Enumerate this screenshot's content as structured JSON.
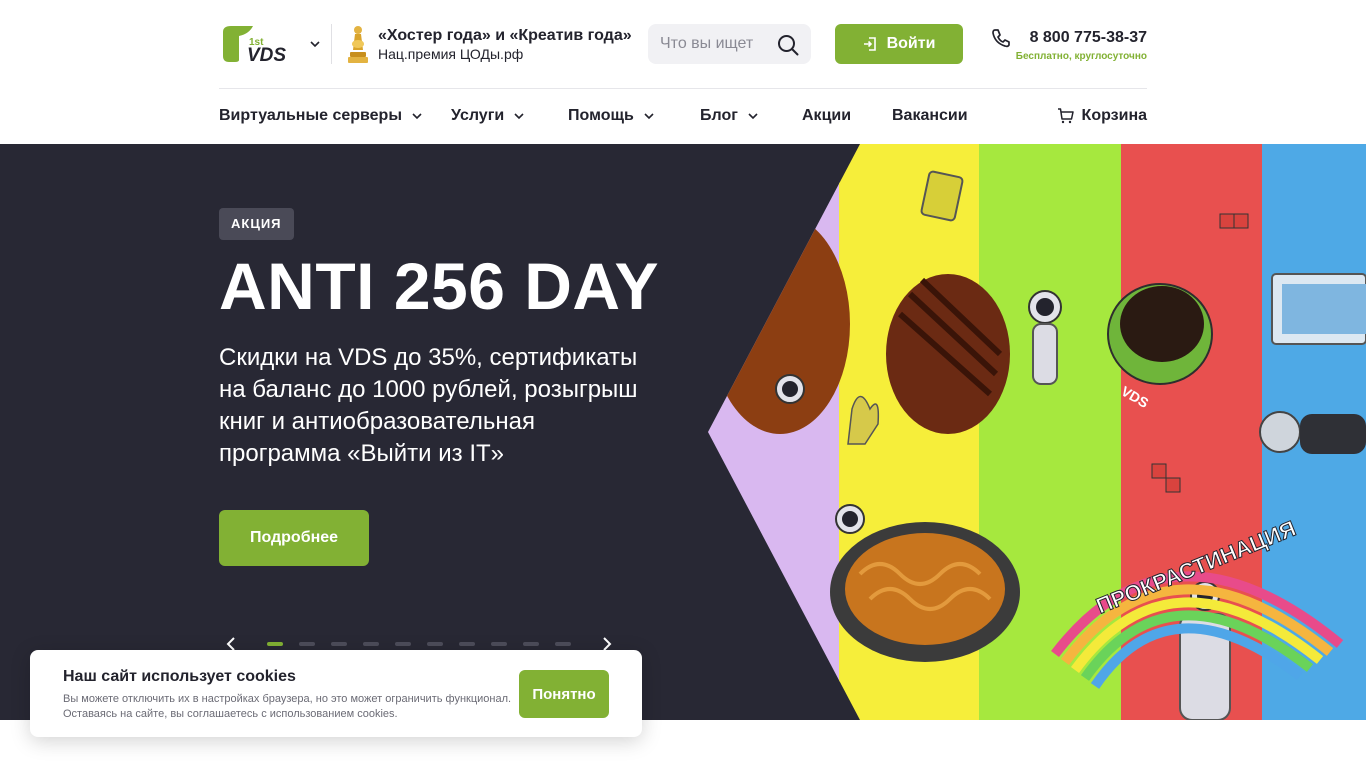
{
  "brand": {
    "logo_text": "VDS",
    "logo_sup": "1st",
    "accent": "#82b134",
    "dark": "#282834"
  },
  "award": {
    "title": "«Хостер года» и «Креатив года»",
    "subtitle": "Нац.премия ЦОДы.рф"
  },
  "search": {
    "placeholder": "Что вы ищет"
  },
  "login": {
    "label": "Войти"
  },
  "contact": {
    "phone": "8 800 775-38-37",
    "note": "Бесплатно, круглосуточно"
  },
  "nav": {
    "items": [
      {
        "label": "Виртуальные серверы",
        "dropdown": true
      },
      {
        "label": "Услуги",
        "dropdown": true
      },
      {
        "label": "Помощь",
        "dropdown": true
      },
      {
        "label": "Блог",
        "dropdown": true
      },
      {
        "label": "Акции",
        "dropdown": false
      },
      {
        "label": "Вакансии",
        "dropdown": false
      }
    ],
    "cart_label": "Корзина"
  },
  "hero": {
    "badge": "АКЦИЯ",
    "title": "ANTI 256 DAY",
    "text": "Скидки на VDS до 35%, сертификаты на баланс до 1000 рублей, розыгрыш книг и антиобразовательная программа «Выйти из IT»",
    "button": "Подробнее",
    "slides_total": 10,
    "active_slide": 1,
    "art_label": "ПРОКРАСТИНАЦИЯ",
    "cup_label": "VDS"
  },
  "cookie": {
    "title": "Наш сайт использует cookies",
    "text": "Вы можете отключить их в настройках браузера, но это может ограничить функционал. Оставаясь на сайте, вы соглашаетесь с использованием cookies.",
    "button": "Понятно"
  }
}
